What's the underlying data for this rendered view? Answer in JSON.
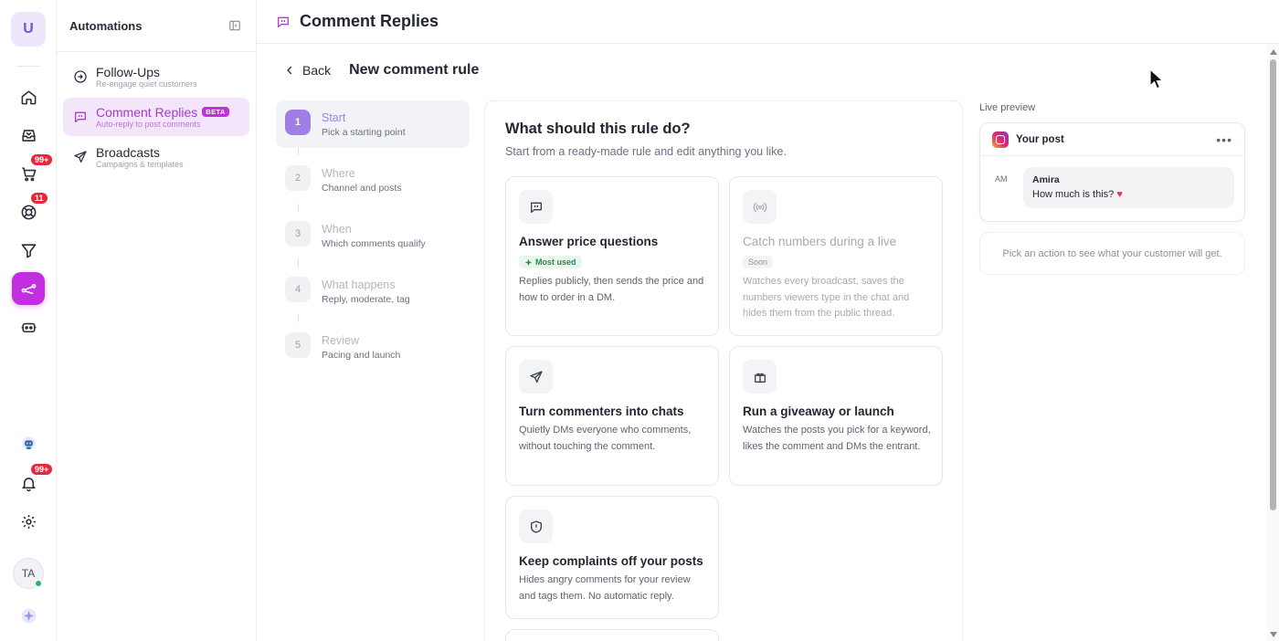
{
  "rail": {
    "logo": "U",
    "badges": {
      "orders": "99+",
      "support": "11",
      "notifications": "99+"
    },
    "avatar_initials": "TA"
  },
  "nav": {
    "title": "Automations",
    "items": [
      {
        "label": "Follow-Ups",
        "sub": "Re-engage quiet customers",
        "icon": "follow-up-icon",
        "active": false
      },
      {
        "label": "Comment Replies",
        "badge": "BETA",
        "sub": "Auto-reply to post comments",
        "icon": "comment-icon",
        "active": true
      },
      {
        "label": "Broadcasts",
        "sub": "Campaigns & templates",
        "icon": "send-icon",
        "active": false
      }
    ]
  },
  "header": {
    "title": "Comment Replies"
  },
  "page": {
    "back_label": "Back",
    "title": "New comment rule"
  },
  "steps": [
    {
      "num": "1",
      "label": "Start",
      "sub": "Pick a starting point",
      "active": true
    },
    {
      "num": "2",
      "label": "Where",
      "sub": "Channel and posts",
      "active": false
    },
    {
      "num": "3",
      "label": "When",
      "sub": "Which comments qualify",
      "active": false
    },
    {
      "num": "4",
      "label": "What happens",
      "sub": "Reply, moderate, tag",
      "active": false
    },
    {
      "num": "5",
      "label": "Review",
      "sub": "Pacing and launch",
      "active": false
    }
  ],
  "panel": {
    "title": "What should this rule do?",
    "subtitle": "Start from a ready-made rule and edit anything you like.",
    "cards": [
      {
        "title": "Answer price questions",
        "tag": "Most used",
        "desc": "Replies publicly, then sends the price and how to order in a DM.",
        "icon": "chat-bubble-icon"
      },
      {
        "title": "Catch numbers during a live",
        "tag": "Soon",
        "desc": "Watches every broadcast, saves the numbers viewers type in the chat and hides them from the public thread.",
        "icon": "broadcast-icon"
      },
      {
        "title": "Turn commenters into chats",
        "desc": "Quietly DMs everyone who comments, without touching the comment.",
        "icon": "paper-plane-icon"
      },
      {
        "title": "Run a giveaway or launch",
        "desc": "Watches the posts you pick for a keyword, likes the comment and DMs the entrant.",
        "icon": "gift-icon"
      },
      {
        "title": "Keep complaints off your posts",
        "desc": "Hides angry comments for your review and tags them. No automatic reply.",
        "icon": "shield-icon"
      }
    ]
  },
  "preview": {
    "label": "Live preview",
    "post_title": "Your post",
    "commenter_initials": "AM",
    "commenter_name": "Amira",
    "comment_text": "How much is this?",
    "hint": "Pick an action to see what your customer will get."
  },
  "colors": {
    "accent": "#c22ee0",
    "step_accent": "#9f7fe6",
    "badge_red": "#e5283c",
    "tag_green": "#1f8c4a"
  }
}
